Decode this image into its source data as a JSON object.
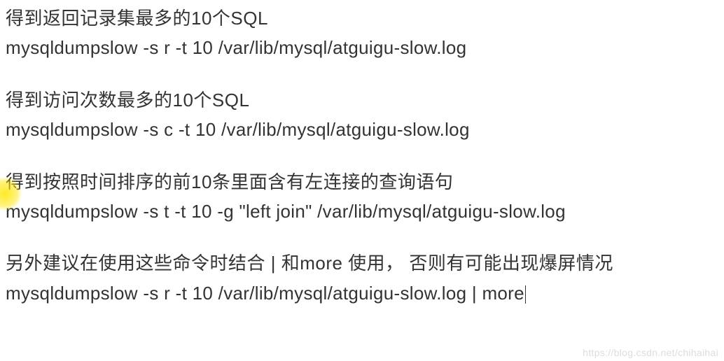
{
  "sections": [
    {
      "description": "得到返回记录集最多的10个SQL",
      "command": "mysqldumpslow -s r -t 10 /var/lib/mysql/atguigu-slow.log"
    },
    {
      "description": "得到访问次数最多的10个SQL",
      "command": "mysqldumpslow -s c -t 10 /var/lib/mysql/atguigu-slow.log"
    },
    {
      "description": "得到按照时间排序的前10条里面含有左连接的查询语句",
      "command": "mysqldumpslow -s t -t 10 -g \"left join\" /var/lib/mysql/atguigu-slow.log"
    },
    {
      "description": "另外建议在使用这些命令时结合 | 和more 使用， 否则有可能出现爆屏情况",
      "command": "mysqldumpslow -s r -t 10 /var/lib/mysql/atguigu-slow.log | more"
    }
  ],
  "watermark": "https://blog.csdn.net/chihaihai"
}
